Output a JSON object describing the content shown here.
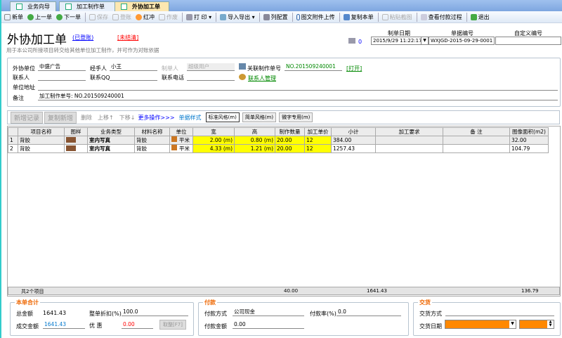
{
  "tabs": [
    {
      "label": "业务向导"
    },
    {
      "label": "加工制作单"
    },
    {
      "label": "外协加工单",
      "active": true
    }
  ],
  "toolbar": {
    "new": "新单",
    "prev": "上一单",
    "next": "下一单",
    "save": "保存",
    "post": "登账",
    "red": "红冲",
    "void": "作废",
    "print": "打 印",
    "import_export": "导入导出",
    "columns": "列配置",
    "upload": "图文附件上传",
    "copy": "复制本单",
    "paste": "粘贴截图",
    "view_payment": "查看付款过程",
    "exit": "退出"
  },
  "header": {
    "title": "外协加工单",
    "posted": "(已登账)",
    "unsettled": "[未结清]",
    "subtitle": "用于本公司所接项目转交给其他单位加工制作，并可作为对账依据",
    "print_count": "0",
    "date_label": "制单日期",
    "date_value": "2015/9/29 11:22:17",
    "number_label": "单据编号",
    "number_value": "WXJGD-2015-09-29-0001",
    "custom_label": "自定义编号",
    "custom_value": ""
  },
  "form": {
    "vendor_label": "外协单位",
    "vendor": "中盛广告",
    "handler_label": "经手人",
    "handler": "小王",
    "maker_label": "制单人",
    "maker": "超级用户",
    "linked_label": "关联制作单号",
    "linked": "NO.201509240001",
    "open": "[打开]",
    "contact_label": "联系人",
    "contact": "",
    "qq_label": "联系QQ",
    "qq": "",
    "phone_label": "联系电话",
    "phone": "",
    "contact_mgmt": "联系人管理",
    "address_label": "单位地址",
    "address": "",
    "remark_label": "备注",
    "remark": "加工制作单号: NO.201509240001"
  },
  "gridbar": {
    "add": "新增记录",
    "copy_add": "复制新增",
    "delete": "删除",
    "up": "上移↑",
    "down": "下移↓",
    "more": "更多操作>>>",
    "style_label": "单据样式",
    "styles": [
      "标准风格(m)",
      "简单风格(m)",
      "微字专用(m)"
    ]
  },
  "table": {
    "columns": [
      "",
      "项目名称",
      "图样",
      "业务类型",
      "材料名称",
      "单位",
      "宽",
      "高",
      "制作数量",
      "加工单价",
      "小计",
      "加工要求",
      "备 注",
      "图像面积(m2)"
    ],
    "rows": [
      [
        "1",
        "背胶",
        "",
        "室内写真",
        "背胶",
        "平米",
        "2.00 (m)",
        "0.80 (m)",
        "20.00",
        "12",
        "384.00",
        "",
        "",
        "32.00"
      ],
      [
        "2",
        "背胶",
        "",
        "室内写真",
        "背胶",
        "平米",
        "4.33 (m)",
        "1.21 (m)",
        "20.00",
        "12",
        "1257.43",
        "",
        "",
        "104.79"
      ]
    ],
    "footer": {
      "count": "共2个项目",
      "qty": "40.00",
      "subtotal": "1641.43",
      "area": "136.79"
    }
  },
  "summary": {
    "title": "本单合计",
    "total_label": "总金额",
    "total": "1641.43",
    "discount_label": "整单折扣(%)",
    "discount": "100.0",
    "deal_label": "成交金额",
    "deal": "1641.43",
    "promo_label": "优 惠",
    "promo": "0.00",
    "cancel": "取整[F7]"
  },
  "payment": {
    "title": "付款",
    "method_label": "付款方式",
    "method": "公司现金",
    "rate_label": "付款率(%)",
    "rate": "0.0",
    "amount_label": "付款金额",
    "amount": "0.00"
  },
  "delivery": {
    "title": "交货",
    "method_label": "交货方式",
    "method": "",
    "date_label": "交货日期",
    "date": ""
  },
  "colors": {
    "accent": "#ff8000",
    "highlight": "#ffff00"
  }
}
